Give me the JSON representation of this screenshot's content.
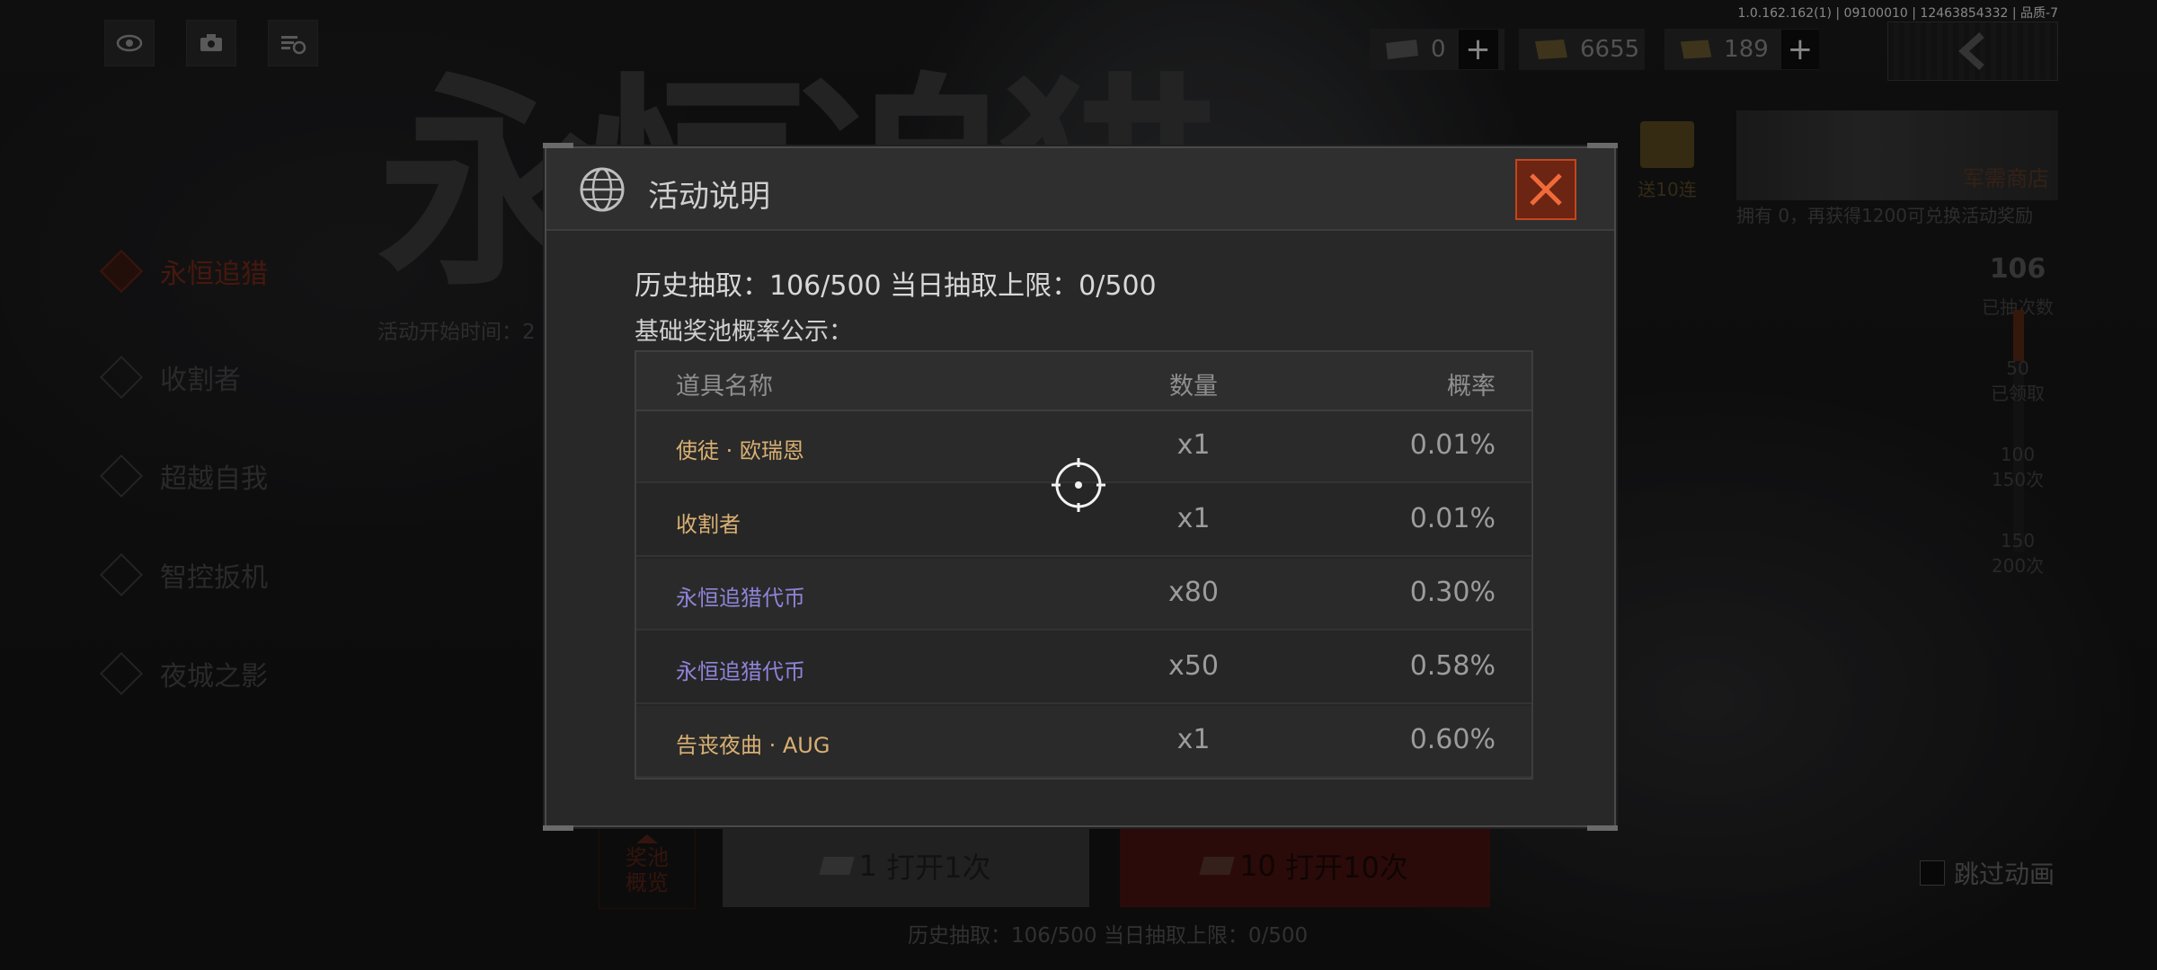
{
  "build_info": "1.0.162.162(1) | 09100010 | 12463854332 | 品质-7",
  "top_icons": [
    "eye-icon",
    "camera-icon",
    "list-settings-icon"
  ],
  "currencies": [
    {
      "icon": "ticket-icon",
      "value": "0",
      "has_plus": true
    },
    {
      "icon": "coupon-icon",
      "value": "6655",
      "has_plus": false
    },
    {
      "icon": "voucher-icon",
      "value": "189",
      "has_plus": true
    }
  ],
  "event": {
    "title_art": "永恒追猎",
    "start_time_label": "活动开始时间：2"
  },
  "menu": [
    {
      "label": "永恒追猎",
      "active": true
    },
    {
      "label": "收割者",
      "active": false
    },
    {
      "label": "超越自我",
      "active": false
    },
    {
      "label": "智控扳机",
      "active": false
    },
    {
      "label": "夜城之影",
      "active": false
    },
    {
      "label": "",
      "active": false
    }
  ],
  "right_panel": {
    "gift_label": "送10连",
    "shop_label": "军需商店",
    "shop_note": "拥有 0，再获得1200可兑换活动奖励",
    "draw_count": "106",
    "draw_count_label": "已抽次数",
    "milestones": [
      {
        "value": "50",
        "label": "已领取"
      },
      {
        "value": "100",
        "label": "150次"
      },
      {
        "value": "150",
        "label": "200次"
      }
    ],
    "progress_fraction": 0.212,
    "skip_label": "跳过动画"
  },
  "bottom": {
    "pool_label_1": "奖池",
    "pool_label_2": "概览",
    "draw1_count": "1",
    "draw1_label": "打开1次",
    "draw10_count": "10",
    "draw10_label": "打开10次",
    "status": "历史抽取：106/500   当日抽取上限：0/500"
  },
  "dialog": {
    "title": "活动说明",
    "stat_line": "历史抽取：106/500  当日抽取上限：0/500",
    "pool_heading": "基础奖池概率公示：",
    "columns": {
      "name": "道具名称",
      "qty": "数量",
      "prob": "概率"
    },
    "rows": [
      {
        "name": "使徒 · 欧瑞恩",
        "qty": "x1",
        "prob": "0.01%",
        "color": "#d9b073"
      },
      {
        "name": "收割者",
        "qty": "x1",
        "prob": "0.01%",
        "color": "#d9b073"
      },
      {
        "name": "永恒追猎代币",
        "qty": "x80",
        "prob": "0.30%",
        "color": "#8f84d9"
      },
      {
        "name": "永恒追猎代币",
        "qty": "x50",
        "prob": "0.58%",
        "color": "#8f84d9"
      },
      {
        "name": "告丧夜曲 · AUG",
        "qty": "x1",
        "prob": "0.60%",
        "color": "#d9b073"
      }
    ]
  },
  "colors": {
    "accent_red": "#c4451e",
    "rarity_gold": "#d9b073",
    "rarity_purple": "#8f84d9"
  }
}
